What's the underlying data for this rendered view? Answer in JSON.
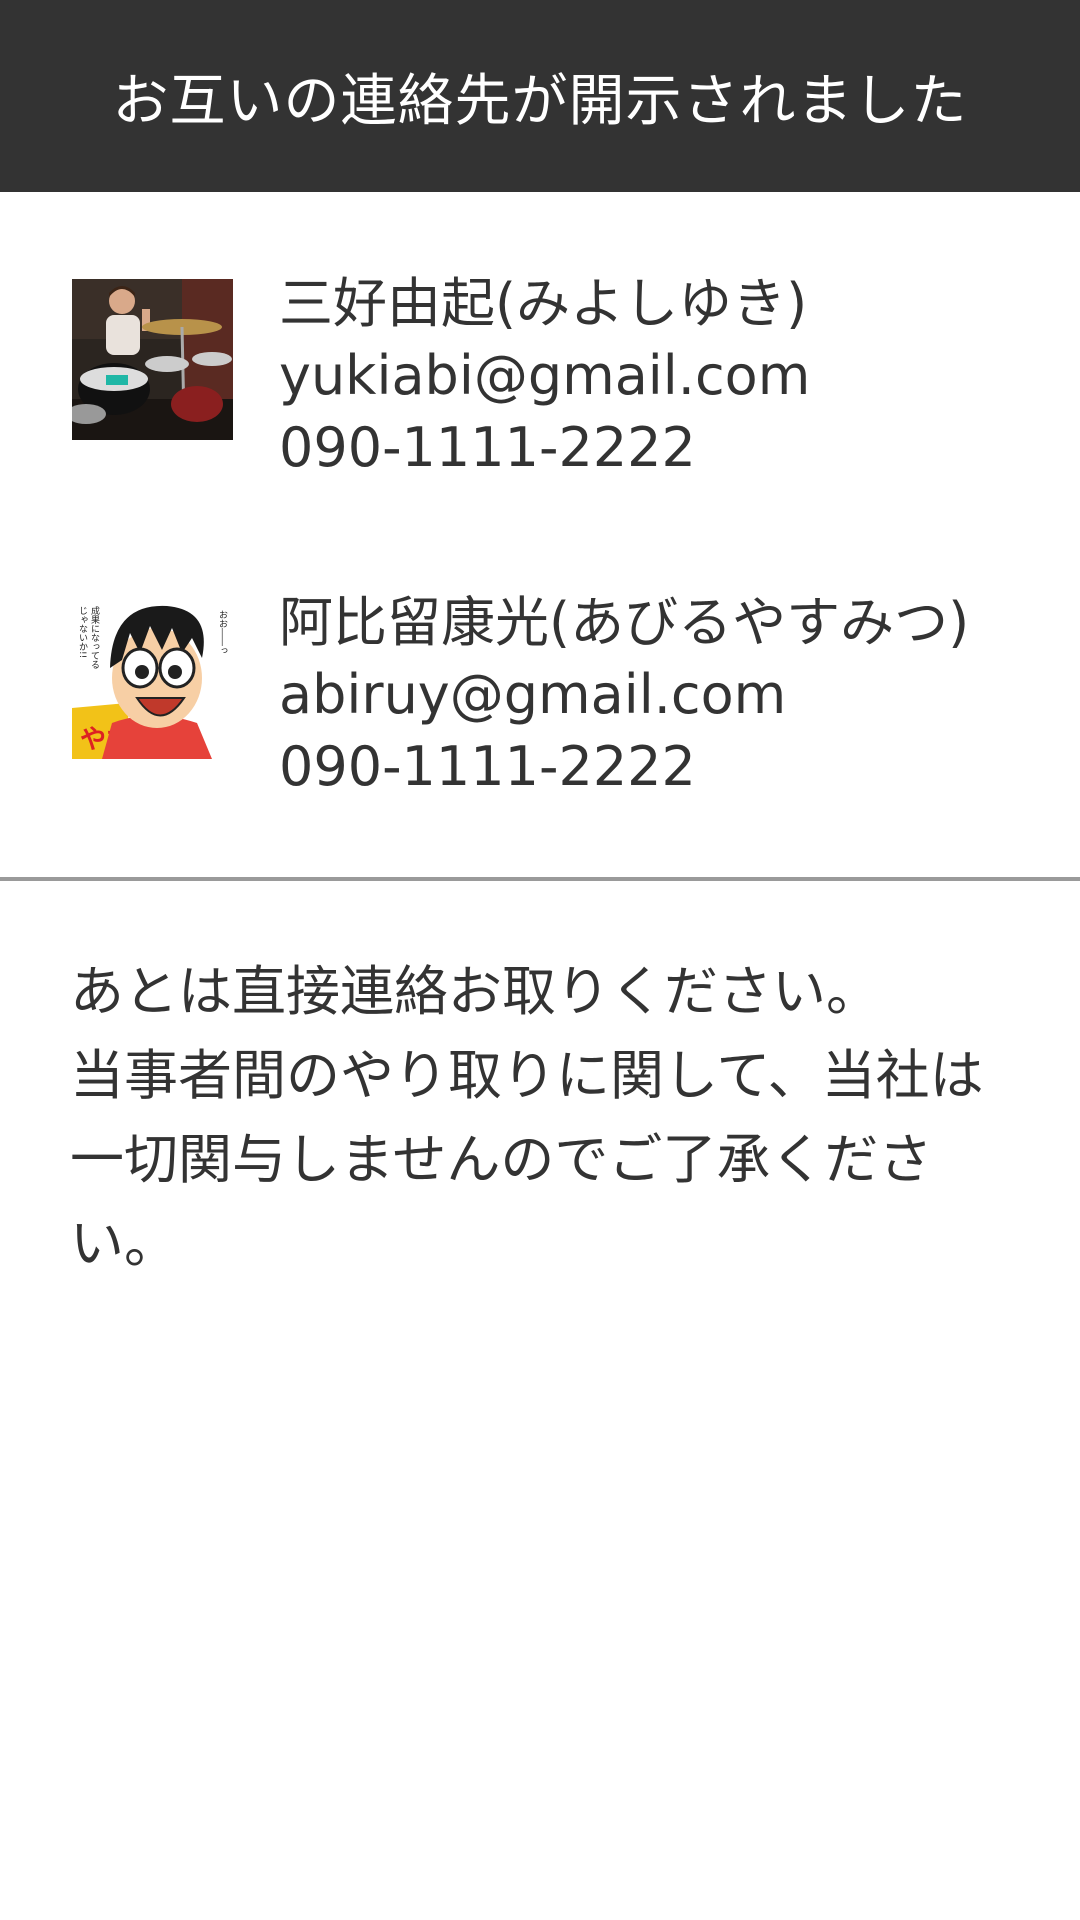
{
  "header": {
    "title": "お互いの連絡先が開示されました"
  },
  "contacts": [
    {
      "name": "三好由起(みよしゆき)",
      "email": "yukiabi@gmail.com",
      "phone": "090-1111-2222",
      "avatar_icon": "drummer-photo"
    },
    {
      "name": "阿比留康光(あびるやすみつ)",
      "email": "abiruy@gmail.com",
      "phone": "090-1111-2222",
      "avatar_icon": "cartoon-illustration",
      "avatar_caption_1": "おお――っ",
      "avatar_caption_2": "成果になってる",
      "avatar_caption_3": "じゃないか!!"
    }
  ],
  "notice": {
    "line1": "あとは直接連絡お取りください。",
    "line2": "当事者間のやり取りに関して、当社は",
    "line3": "一切関与しませんのでご了承くださ",
    "line4": "い。"
  },
  "colors": {
    "header_bg": "#333333",
    "header_text": "#ffffff",
    "body_text": "#333333",
    "divider": "#9a9a9a"
  }
}
